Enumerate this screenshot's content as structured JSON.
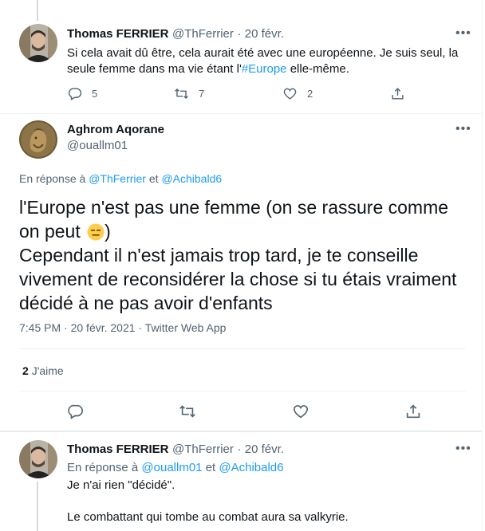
{
  "tweet1": {
    "name": "Thomas FERRIER",
    "handle": "@ThFerrier",
    "dot": "·",
    "date": "20 févr.",
    "text_before": "Si cela avait dû être, cela aurait été avec une européenne. Je suis seul, la seule femme dans ma vie étant l'",
    "hashtag": "#Europe",
    "text_after": " elle-même.",
    "replies": "5",
    "retweets": "7",
    "likes": "2"
  },
  "main": {
    "name": "Aghrom Aqorane",
    "handle": "@ouallm01",
    "reply_prefix": "En réponse à",
    "reply_to_1": "@ThFerrier",
    "reply_and": "et",
    "reply_to_2": "@Achibald6",
    "text_line1": "l'Europe n'est pas une femme (on se rassure comme on peut",
    "emoji_close": ")",
    "text_line2": "Cependant il n'est jamais trop tard, je te conseille vivement de reconsidérer la chose si tu étais vraiment décidé à ne pas avoir d'enfants",
    "time": "7:45 PM",
    "date": "20 févr. 2021",
    "source": "Twitter Web App",
    "likes_count": "2",
    "likes_label": "J'aime"
  },
  "tweet3": {
    "name": "Thomas FERRIER",
    "handle": "@ThFerrier",
    "dot": "·",
    "date": "20 févr.",
    "reply_prefix": "En réponse à",
    "reply_to_1": "@ouallm01",
    "reply_and": "et",
    "reply_to_2": "@Achibald6",
    "line1": "Je n'ai rien \"décidé\".",
    "line2": "Le combattant qui tombe au combat aura sa valkyrie."
  },
  "colors": {
    "accent": "#1d9bf0",
    "secondary": "#536471",
    "text": "#0f1419",
    "border": "#eff3f4",
    "emoji": "#ffcc4d"
  },
  "icons": [
    "reply-icon",
    "retweet-icon",
    "like-icon",
    "share-icon",
    "more-icon"
  ]
}
